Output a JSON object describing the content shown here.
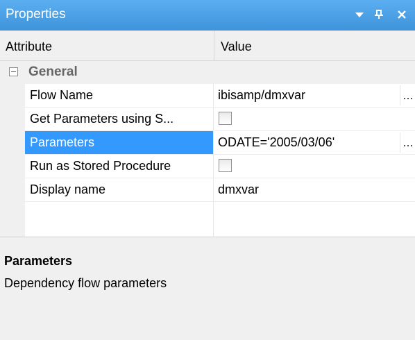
{
  "window": {
    "title": "Properties",
    "menu_icon": "down-triangle",
    "pin_icon": "pin",
    "close_icon": "close",
    "titlebar_color": "#4a9ee5"
  },
  "columns": {
    "attribute": "Attribute",
    "value": "Value"
  },
  "category": {
    "label": "General",
    "expander_icon": "minus-box",
    "expanded": true
  },
  "properties": [
    {
      "name": "Flow Name",
      "value": "ibisamp/dmxvar",
      "type": "text-ellipsis",
      "button": "..."
    },
    {
      "name": "Get Parameters using S...",
      "type": "checkbox",
      "checked": false
    },
    {
      "name": "Parameters",
      "value": "ODATE='2005/03/06'",
      "type": "text-ellipsis",
      "button": "...",
      "selected": true
    },
    {
      "name": "Run as Stored Procedure",
      "type": "checkbox",
      "checked": false
    },
    {
      "name": "Display name",
      "value": "dmxvar",
      "type": "text"
    }
  ],
  "help": {
    "title": "Parameters",
    "description": "Dependency flow parameters"
  },
  "colors": {
    "selection": "#3399ff",
    "grid_margin": "#f0f0f0"
  }
}
